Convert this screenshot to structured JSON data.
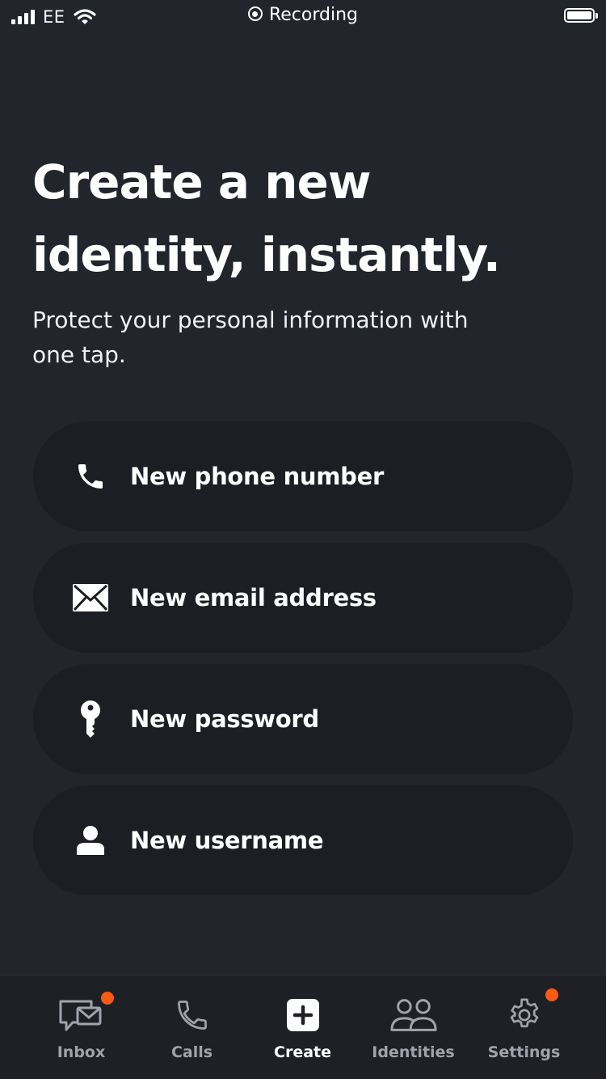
{
  "status_bar": {
    "carrier": "EE",
    "recording_label": "Recording",
    "signal_icon": "cellular-signal-icon",
    "wifi_icon": "wifi-icon",
    "battery_icon": "battery-icon"
  },
  "hero": {
    "title_line1": "Create a new",
    "title_line2": "identity, instantly.",
    "subtitle": "Protect your personal information with one tap."
  },
  "options": [
    {
      "label": "New phone number",
      "icon": "phone-icon"
    },
    {
      "label": "New email address",
      "icon": "envelope-icon"
    },
    {
      "label": "New password",
      "icon": "key-icon"
    },
    {
      "label": "New username",
      "icon": "person-icon"
    }
  ],
  "tab_bar": {
    "active_tab": "Create",
    "tabs": [
      {
        "label": "Inbox",
        "icon": "inbox-icon",
        "badge": true
      },
      {
        "label": "Calls",
        "icon": "phone-outline-icon",
        "badge": false
      },
      {
        "label": "Create",
        "icon": "plus-square-icon",
        "badge": false
      },
      {
        "label": "Identities",
        "icon": "people-icon",
        "badge": false
      },
      {
        "label": "Settings",
        "icon": "gear-icon",
        "badge": true
      }
    ]
  },
  "colors": {
    "background": "#23252d",
    "card": "#1c1e24",
    "tab_bar": "#1e2026",
    "tab_inactive": "#a0a3ad",
    "badge": "#fa5a14"
  }
}
